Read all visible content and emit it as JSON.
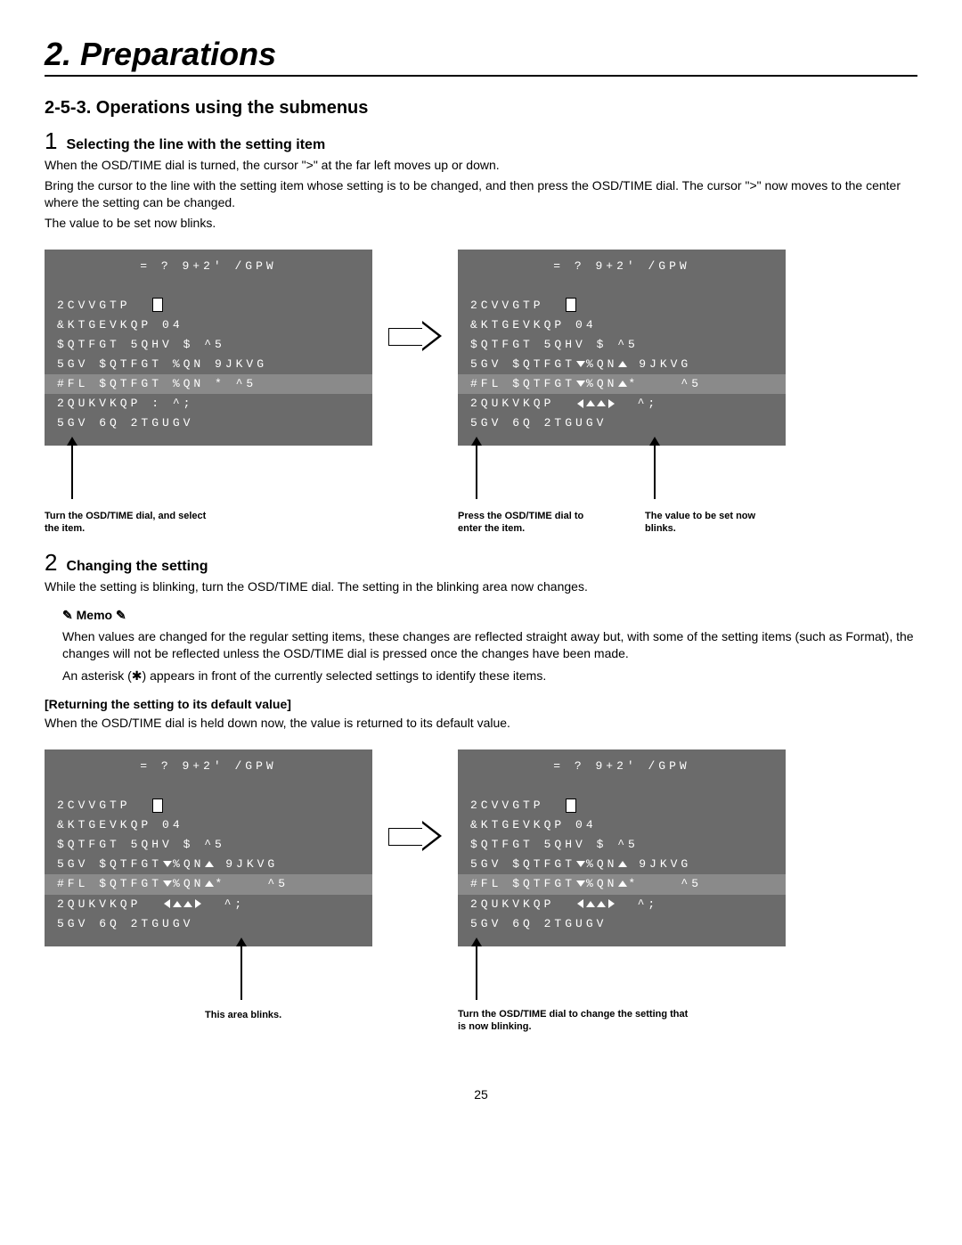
{
  "chapter": "2. Preparations",
  "section": "2-5-3. Operations using the submenus",
  "step1": {
    "num": "1",
    "title": "Selecting the line with the setting item",
    "p1": "When the OSD/TIME dial is turned, the cursor \">\" at the far left moves up or down.",
    "p2": "Bring the cursor to the line with the setting item whose setting is to be changed, and then press the OSD/TIME dial. The cursor \">\" now moves to the center where the setting can be changed.",
    "p3": "The value to be set now blinks."
  },
  "screen": {
    "title": "= ? 9+2' /GPW",
    "l_pattern": "2CVVGTP",
    "l_direction": "&KTGEVKQP      04",
    "l_bordersoft": "$QTFGT 5QHV    $    ^5",
    "l_setborder": "5GV $QTFGT %QN 9JKVG",
    "l_bkl": "#FL $QTFGT %QN *    ^5",
    "l_position": "2QUKVKQP       :    ^;",
    "l_setto": "5GV 6Q 2TGUGV"
  },
  "labels1": {
    "a": "Turn the OSD/TIME dial, and select the item.",
    "b": "Press the OSD/TIME dial to enter the item.",
    "c": "The value to be set now blinks."
  },
  "step2": {
    "num": "2",
    "title": "Changing the setting",
    "p1": "While the setting is blinking, turn the OSD/TIME dial. The setting in the blinking area now changes."
  },
  "memo": {
    "title": "✎ Memo ✎",
    "p1": "When values are changed for the regular setting items, these changes are reflected straight away but, with some of the setting items (such as Format), the changes will not be reflected unless the OSD/TIME dial is pressed once the changes have been made.",
    "p2": "An asterisk (✱) appears in front of the currently selected settings to identify these items."
  },
  "returning": {
    "title": "[Returning the setting to its default value]",
    "p1": "When the OSD/TIME dial is held down now, the value is returned to its default value."
  },
  "labels2": {
    "a": "This area blinks.",
    "b": "Turn the OSD/TIME dial to change the setting that is now blinking."
  },
  "pageNumber": "25"
}
